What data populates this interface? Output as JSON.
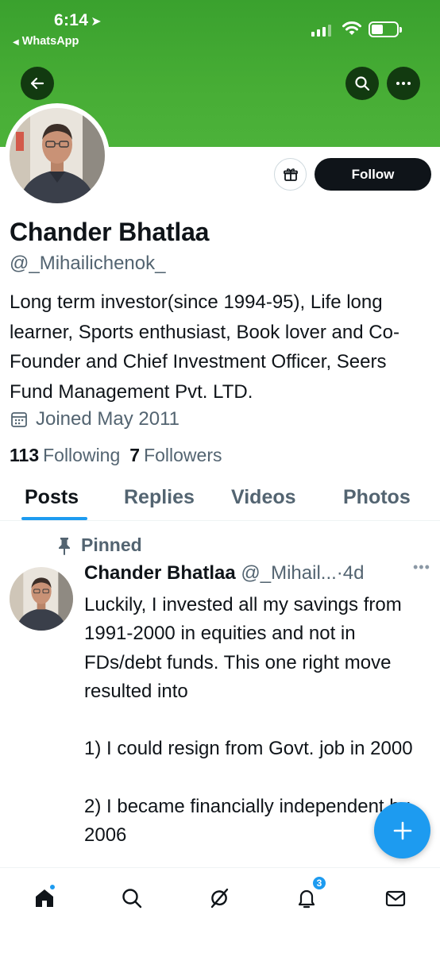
{
  "status_bar": {
    "time": "6:14",
    "back_app": "WhatsApp"
  },
  "profile": {
    "name": "Chander Bhatlaa",
    "handle": "@_Mihailichenok_",
    "bio": "Long term investor(since 1994-95), Life long learner, Sports enthusiast, Book lover and Co-Founder and Chief Investment Officer, Seers Fund Management Pvt. LTD.",
    "joined": "Joined May 2011",
    "following_count": "113",
    "following_label": "Following",
    "followers_count": "7",
    "followers_label": "Followers",
    "follow_label": "Follow"
  },
  "tabs": [
    {
      "label": "Posts",
      "active": true
    },
    {
      "label": "Replies",
      "active": false
    },
    {
      "label": "Videos",
      "active": false
    },
    {
      "label": "Photos",
      "active": false
    }
  ],
  "post": {
    "pinned_label": "Pinned",
    "author": "Chander Bhatlaa",
    "handle": "@_Mihail...",
    "separator": "·",
    "time": "4d",
    "text": "Luckily, I invested all my savings from 1991-2000 in equities and not in FDs/debt funds. This one right move resulted into\n\n1) I could resign from Govt. job in 2000\n\n2) I became financially independent by 2006"
  },
  "bottom_nav": {
    "notifications_badge": "3"
  },
  "colors": {
    "banner": "#47ad35",
    "accent": "#1d9bf0",
    "text_primary": "#0f1419",
    "text_secondary": "#536471"
  },
  "icons": [
    "back-arrow-icon",
    "search-icon",
    "more-icon",
    "gift-icon",
    "calendar-icon",
    "pin-icon",
    "compose-plus-icon",
    "home-icon",
    "grok-icon",
    "bell-icon",
    "mail-icon"
  ]
}
